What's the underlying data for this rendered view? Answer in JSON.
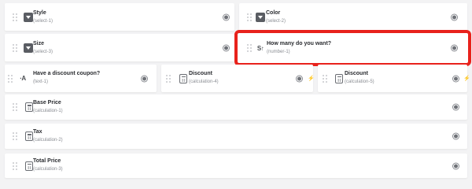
{
  "fields": [
    {
      "title": "Style",
      "sub": "(select-1)",
      "icon": "select-icon"
    },
    {
      "title": "Color",
      "sub": "(select-2)",
      "icon": "select-icon"
    },
    {
      "title": "Size",
      "sub": "(select-3)",
      "icon": "select-icon"
    },
    {
      "title": "How many do you want?",
      "sub": "(number-1)",
      "icon": "number-icon",
      "icon_text": "S↑"
    },
    {
      "title": "Have a discount coupon?",
      "sub": "(text-1)",
      "icon": "text-icon",
      "icon_text": "·A"
    },
    {
      "title": "Discount",
      "sub": "(calculation-4)",
      "icon": "calculator-icon"
    },
    {
      "title": "Discount",
      "sub": "(calculation-5)",
      "icon": "calculator-icon"
    },
    {
      "title": "Base Price",
      "sub": "(calculation-1)",
      "icon": "calculator-icon"
    },
    {
      "title": "Tax",
      "sub": "(calculation-2)",
      "icon": "calculator-icon"
    },
    {
      "title": "Total Price",
      "sub": "(calculation-3)",
      "icon": "calculator-icon"
    }
  ],
  "colors": {
    "background": "#f3f3f4",
    "card": "#ffffff",
    "highlight_border": "#e8221c",
    "bolt": "#f2b400"
  }
}
